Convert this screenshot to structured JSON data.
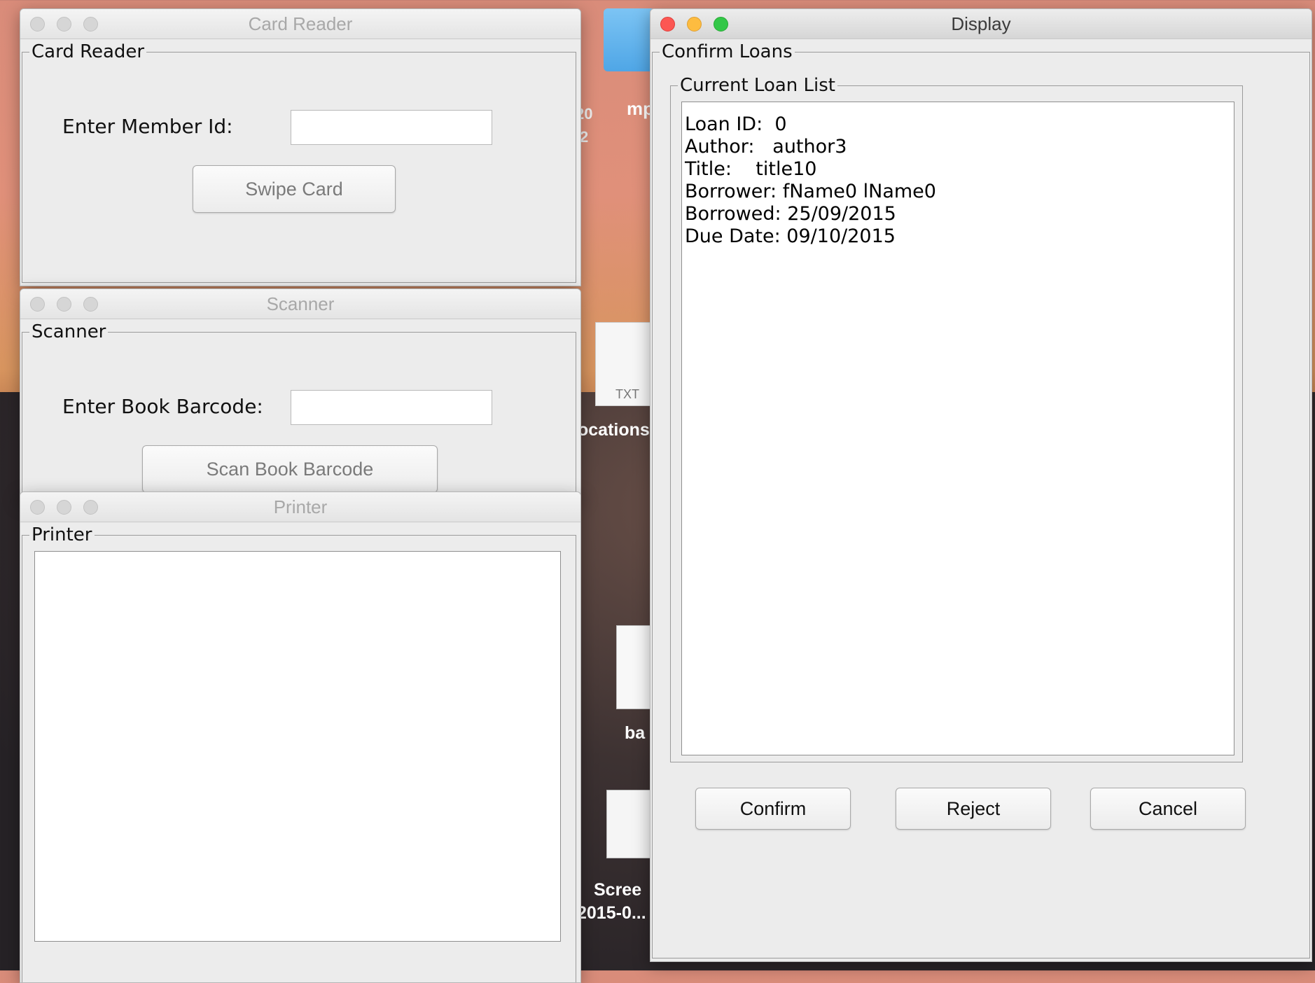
{
  "card_reader": {
    "window_title": "Card Reader",
    "group_title": "Card Reader",
    "member_id_label": "Enter Member Id:",
    "member_id_value": "",
    "swipe_button": "Swipe Card"
  },
  "scanner": {
    "window_title": "Scanner",
    "group_title": "Scanner",
    "barcode_label": "Enter Book Barcode:",
    "barcode_value": "",
    "scan_button": "Scan Book Barcode"
  },
  "printer": {
    "window_title": "Printer",
    "group_title": "Printer",
    "output_text": ""
  },
  "display": {
    "window_title": "Display",
    "group_title": "Confirm Loans",
    "list_title": "Current Loan List",
    "loan_lines": [
      "Loan ID:  0",
      "Author:   author3",
      "Title:    title10",
      "Borrower: fName0 lName0",
      "Borrowed: 25/09/2015",
      "Due Date: 09/10/2015"
    ],
    "confirm_button": "Confirm",
    "reject_button": "Reject",
    "cancel_button": "Cancel"
  },
  "desktop": {
    "icon_labels": [
      "mp",
      "ocations",
      "TXT",
      "ba",
      "Scree",
      "2015-0...",
      "20",
      "2"
    ]
  }
}
